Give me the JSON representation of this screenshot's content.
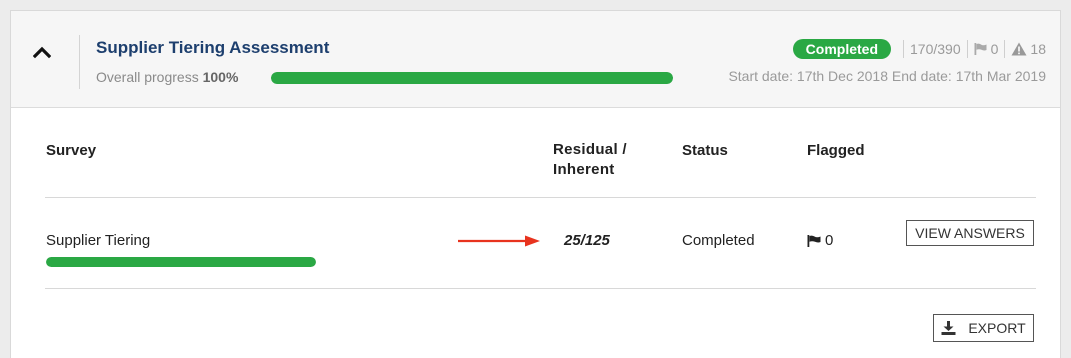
{
  "assessment": {
    "title": "Supplier Tiering Assessment",
    "progress_label": "Overall progress",
    "progress_value": "100%",
    "progress_fraction": 1.0,
    "status_badge": "Completed",
    "answered": "170/390",
    "flag_count": "0",
    "warning_count": "18",
    "dates": "Start date: 17th Dec 2018 End date: 17th Mar 2019"
  },
  "table": {
    "headers": {
      "survey": "Survey",
      "residual_line1": "Residual /",
      "residual_line2": "Inherent",
      "status": "Status",
      "flagged": "Flagged"
    },
    "rows": [
      {
        "survey": "Supplier Tiering",
        "progress_fraction": 1.0,
        "residual_inherent": "25/125",
        "status": "Completed",
        "flagged": "0",
        "action": "VIEW ANSWERS"
      }
    ]
  },
  "export_label": "EXPORT",
  "colors": {
    "accent_green": "#2aa844",
    "title_blue": "#1d3f6e",
    "annotation_red": "#e8331e"
  },
  "icons": [
    "chevron-up-icon",
    "flag-icon",
    "warning-icon",
    "download-icon",
    "red-arrow-annotation"
  ]
}
